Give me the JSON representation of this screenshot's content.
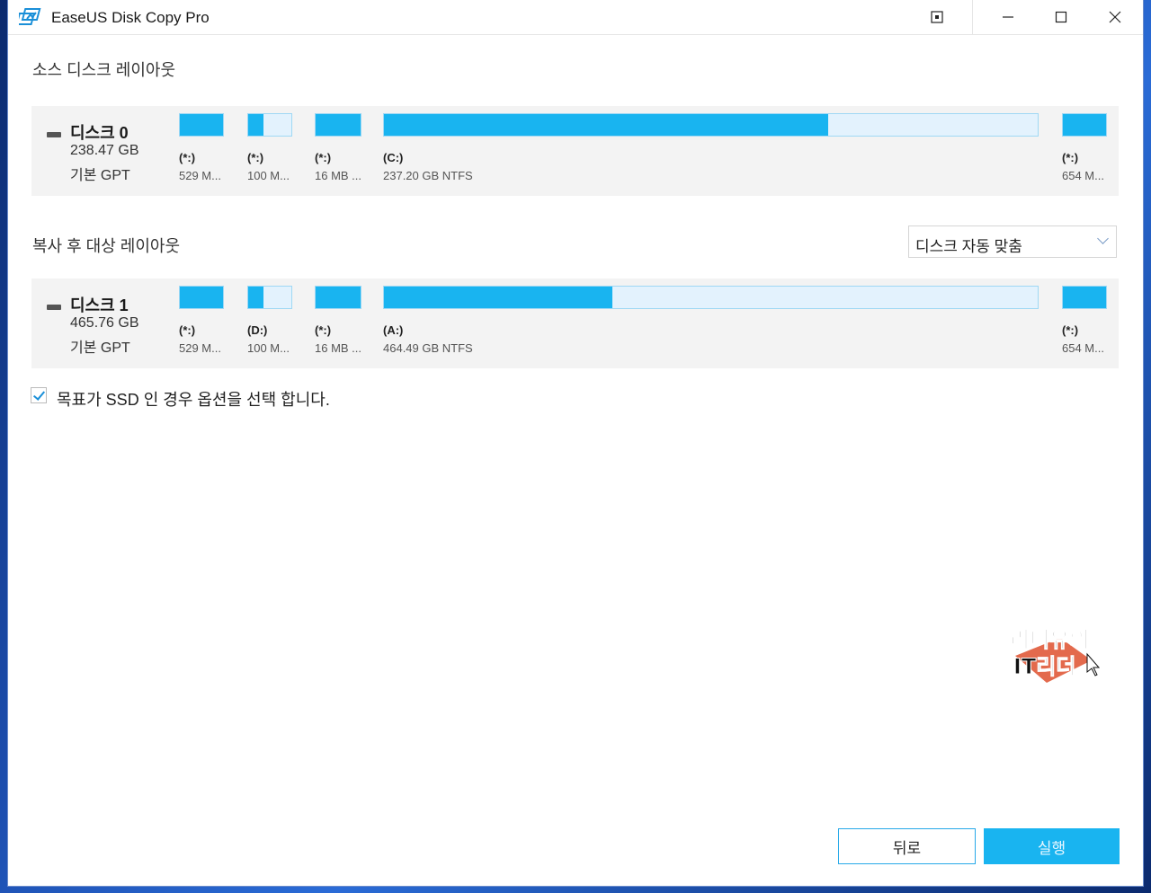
{
  "window": {
    "title": "EaseUS Disk Copy Pro",
    "controls": {
      "restore": "⊡",
      "minimize": "—",
      "maximize": "☐",
      "close": "✕"
    }
  },
  "source": {
    "label": "소스 디스크 레이아웃",
    "disk": {
      "name": "디스크 0",
      "size": "238.47 GB",
      "type": "기본 GPT",
      "partitions": [
        {
          "letter": "(*:)",
          "info": "529 M...",
          "used": 1.0
        },
        {
          "letter": "(*:)",
          "info": "100 M...",
          "used": 0.35
        },
        {
          "letter": "(*:)",
          "info": "16 MB ...",
          "used": 1.0
        },
        {
          "letter": "(C:)",
          "info": "237.20 GB NTFS",
          "used": 0.68
        },
        {
          "letter": "(*:)",
          "info": "654 M...",
          "used": 1.0
        }
      ]
    }
  },
  "target": {
    "label": "복사 후 대상 레이아웃",
    "fit_select": "디스크 자동 맞춤",
    "disk": {
      "name": "디스크 1",
      "size": "465.76 GB",
      "type": "기본 GPT",
      "partitions": [
        {
          "letter": "(*:)",
          "info": "529 M...",
          "used": 1.0
        },
        {
          "letter": "(D:)",
          "info": "100 M...",
          "used": 0.35
        },
        {
          "letter": "(*:)",
          "info": "16 MB ...",
          "used": 1.0
        },
        {
          "letter": "(A:)",
          "info": "464.49 GB NTFS",
          "used": 0.35
        },
        {
          "letter": "(*:)",
          "info": "654 M...",
          "used": 1.0
        }
      ]
    }
  },
  "ssd_option": {
    "label": "목표가 SSD 인 경우 옵션을 선택 합니다.",
    "checked": true
  },
  "watermark": {
    "line1": "리더유의",
    "line2": "IT리더"
  },
  "buttons": {
    "back": "뒤로",
    "run": "실행"
  },
  "colors": {
    "accent": "#19b4f0",
    "partition_free": "#e3f2fd"
  }
}
